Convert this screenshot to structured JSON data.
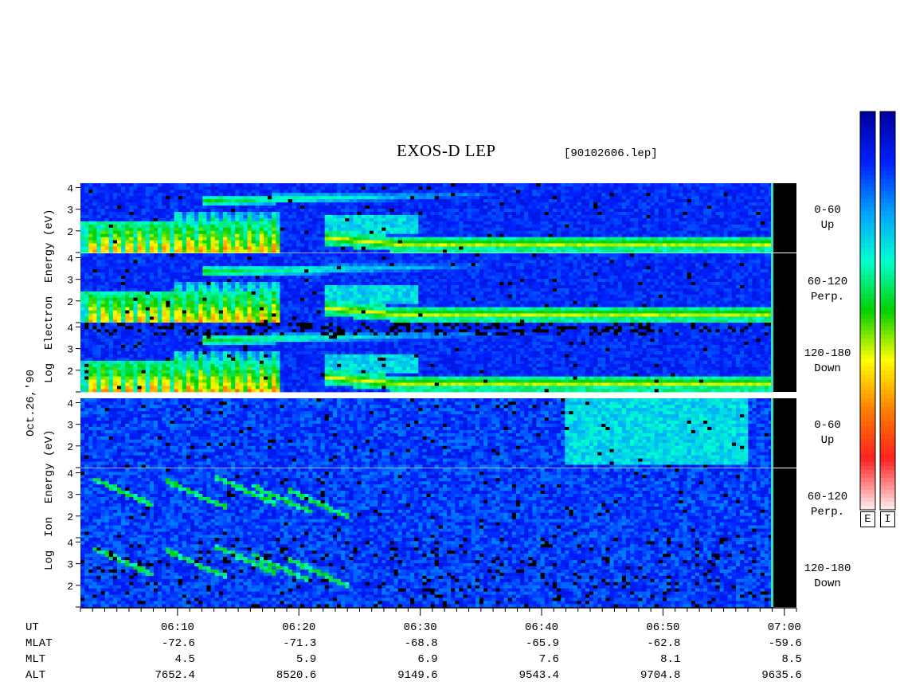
{
  "chart_data": {
    "type": "heatmap",
    "title": "EXOS-D LEP",
    "file_tag": "[90102606.lep]",
    "date_label": "Oct.26,'90",
    "x_axis": {
      "label": "UT",
      "ticks": [
        "06:10",
        "06:20",
        "06:30",
        "06:40",
        "06:50",
        "07:00"
      ],
      "range": [
        "06:02",
        "07:01"
      ]
    },
    "ephemeris": [
      {
        "name": "MLAT",
        "values": [
          "-72.6",
          "-71.3",
          "-68.8",
          "-65.9",
          "-62.8",
          "-59.6"
        ]
      },
      {
        "name": "MLT",
        "values": [
          "4.5",
          "5.9",
          "6.9",
          "7.6",
          "8.1",
          "8.5"
        ]
      },
      {
        "name": "ALT",
        "values": [
          "7652.4",
          "8520.6",
          "9149.6",
          "9543.4",
          "9704.8",
          "9635.6"
        ]
      }
    ],
    "groups": [
      {
        "ylabel": "Log  Electron  Energy (eV)",
        "ylabel_words": [
          "Log",
          "Electron",
          "Energy (eV)"
        ],
        "species": "electron",
        "panels": [
          {
            "angle_label": "0-60",
            "direction": "Up",
            "yticks": [
              "4",
              "3",
              "2"
            ],
            "ylim": [
              1,
              4.2
            ]
          },
          {
            "angle_label": "60-120",
            "direction": "Perp.",
            "yticks": [
              "4",
              "3",
              "2"
            ],
            "ylim": [
              1,
              4.2
            ]
          },
          {
            "angle_label": "120-180",
            "direction": "Down",
            "yticks": [
              "4",
              "3",
              "2"
            ],
            "ylim": [
              1,
              4.2
            ]
          }
        ]
      },
      {
        "ylabel": "Log  Ion  Energy (eV)",
        "ylabel_words": [
          "Log",
          "Ion",
          "Energy (eV)"
        ],
        "species": "ion",
        "panels": [
          {
            "angle_label": "0-60",
            "direction": "Up",
            "yticks": [
              "4",
              "3",
              "2"
            ],
            "ylim": [
              1,
              4.2
            ]
          },
          {
            "angle_label": "60-120",
            "direction": "Perp.",
            "yticks": [
              "4",
              "3",
              "2"
            ],
            "ylim": [
              1,
              4.2
            ]
          },
          {
            "angle_label": "120-180",
            "direction": "Down",
            "yticks": [
              "4",
              "3",
              "2"
            ],
            "ylim": [
              1,
              4.2
            ]
          }
        ]
      }
    ],
    "colorbars": [
      {
        "label": "E"
      },
      {
        "label": "I"
      }
    ],
    "colormap": [
      "#ffe8e8",
      "#ff2020",
      "#ff8000",
      "#ffff00",
      "#00d000",
      "#00ffd0",
      "#00a0ff",
      "#0020ff",
      "#0000a0"
    ],
    "features": {
      "electron_bursts_ut": [
        "06:03",
        "06:04",
        "06:05",
        "06:06",
        "06:07",
        "06:08",
        "06:09",
        "06:10",
        "06:11",
        "06:12",
        "06:13",
        "06:14",
        "06:15",
        "06:16",
        "06:17",
        "06:18"
      ],
      "electron_band_logE_after_0630": 1.4,
      "electron_arc_logE": 3.4,
      "data_end_ut": "06:59"
    }
  }
}
